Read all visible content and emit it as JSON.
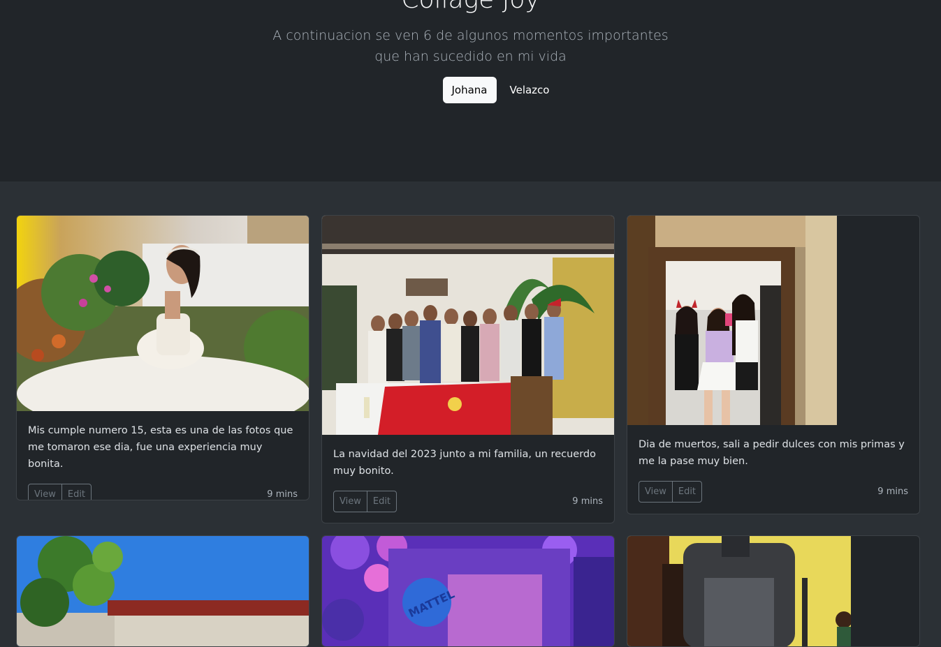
{
  "hero": {
    "title": "Collage Joy",
    "lead": "A continuacion se ven 6 de algunos momentos importantes que han sucedido en mi vida",
    "primary_button": "Johana",
    "secondary_button": "Velazco"
  },
  "cards": [
    {
      "text": "Mis cumple numero 15, esta es una de las fotos que me tomaron ese dia, fue una experiencia muy bonita.",
      "view_label": "View",
      "edit_label": "Edit",
      "time": "9 mins"
    },
    {
      "text": "La navidad del 2023 junto a mi familia, un recuerdo muy bonito.",
      "view_label": "View",
      "edit_label": "Edit",
      "time": "9 mins"
    },
    {
      "text": "Dia de muertos, sali a pedir dulces con mis primas y me la pase muy bien.",
      "view_label": "View",
      "edit_label": "Edit",
      "time": "9 mins"
    }
  ],
  "photo_labels": {
    "balloon_logo": "MATTEL"
  },
  "colors": {
    "hero_bg": "#212529",
    "page_bg": "#2b3035",
    "card_bg": "#212529",
    "muted_text": "#adb5bd",
    "outline": "#6c757d"
  }
}
